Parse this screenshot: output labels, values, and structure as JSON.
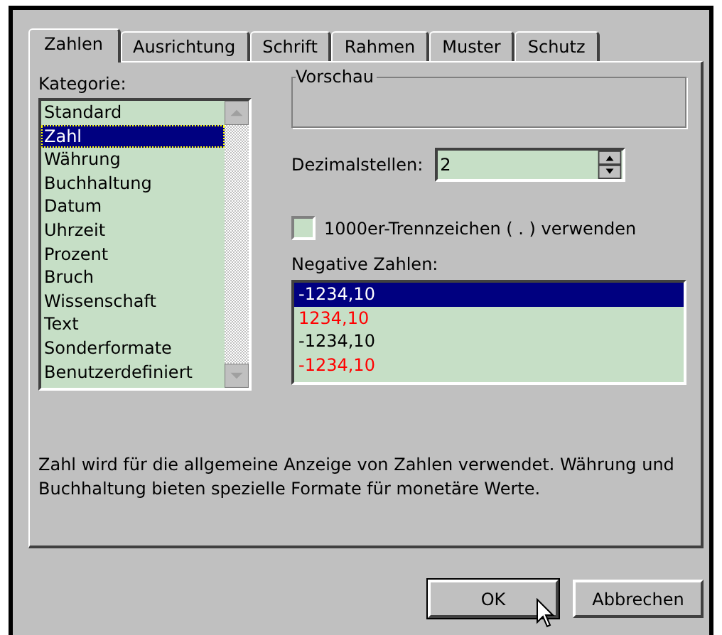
{
  "tabs": [
    {
      "label": "Zahlen",
      "selected": true
    },
    {
      "label": "Ausrichtung",
      "selected": false
    },
    {
      "label": "Schrift",
      "selected": false
    },
    {
      "label": "Rahmen",
      "selected": false
    },
    {
      "label": "Muster",
      "selected": false
    },
    {
      "label": "Schutz",
      "selected": false
    }
  ],
  "category": {
    "label": "Kategorie:",
    "items": [
      {
        "label": "Standard",
        "selected": false
      },
      {
        "label": "Zahl",
        "selected": true
      },
      {
        "label": "Währung",
        "selected": false
      },
      {
        "label": "Buchhaltung",
        "selected": false
      },
      {
        "label": "Datum",
        "selected": false
      },
      {
        "label": "Uhrzeit",
        "selected": false
      },
      {
        "label": "Prozent",
        "selected": false
      },
      {
        "label": "Bruch",
        "selected": false
      },
      {
        "label": "Wissenschaft",
        "selected": false
      },
      {
        "label": "Text",
        "selected": false
      },
      {
        "label": "Sonderformate",
        "selected": false
      },
      {
        "label": "Benutzerdefiniert",
        "selected": false
      }
    ]
  },
  "preview": {
    "label": "Vorschau"
  },
  "decimals": {
    "label": "Dezimalstellen:",
    "value": "2"
  },
  "thousands_separator": {
    "label": "1000er-Trennzeichen ( . ) verwenden",
    "checked": false
  },
  "negative_numbers": {
    "label": "Negative Zahlen:",
    "items": [
      {
        "label": "-1234,10",
        "selected": true
      },
      {
        "label": "1234,10",
        "selected": false,
        "color": "#ff0000"
      },
      {
        "label": "-1234,10",
        "selected": false,
        "color": "#000000"
      },
      {
        "label": "-1234,10",
        "selected": false,
        "color": "#ff0000"
      }
    ]
  },
  "description": "Zahl wird für die allgemeine Anzeige von Zahlen verwendet. Währung und Buchhaltung bieten spezielle Formate für monetäre Werte.",
  "buttons": [
    "OK",
    "Abbrechen"
  ]
}
